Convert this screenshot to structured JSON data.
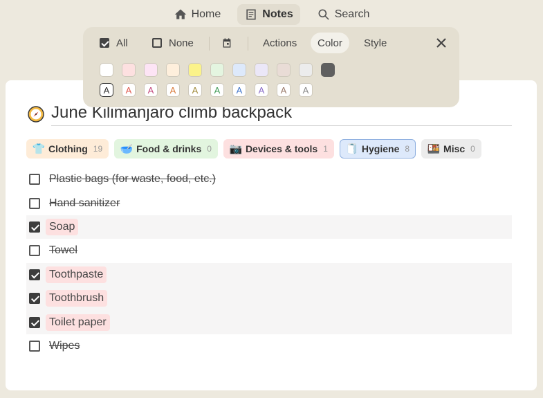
{
  "nav": {
    "home_label": "Home",
    "notes_label": "Notes",
    "search_label": "Search"
  },
  "toolbar": {
    "all_label": "All",
    "none_label": "None",
    "actions_label": "Actions",
    "color_label": "Color",
    "style_label": "Style",
    "background_swatches": [
      "#ffffff",
      "#fde0e0",
      "#fde4f5",
      "#feefdc",
      "#fbf38a",
      "#e4f5e0",
      "#dde9fb",
      "#ebe7f8",
      "#e9dcd6",
      "#ececec",
      "#5f5f5f"
    ],
    "text_swatches": [
      {
        "label": "A",
        "color": "#333333"
      },
      {
        "label": "A",
        "color": "#e05a4f"
      },
      {
        "label": "A",
        "color": "#c2477c"
      },
      {
        "label": "A",
        "color": "#d97a3a"
      },
      {
        "label": "A",
        "color": "#a08a3a"
      },
      {
        "label": "A",
        "color": "#3f9a55"
      },
      {
        "label": "A",
        "color": "#3f74c9"
      },
      {
        "label": "A",
        "color": "#8a6cc8"
      },
      {
        "label": "A",
        "color": "#9a7a6a"
      },
      {
        "label": "A",
        "color": "#888888"
      }
    ]
  },
  "note": {
    "title": "June Kilimanjaro climb backpack"
  },
  "categories": [
    {
      "emoji": "👕",
      "name": "Clothing",
      "count": "19",
      "bg": "#feecd8",
      "border": "#feecd8"
    },
    {
      "emoji": "🥣",
      "name": "Food & drinks",
      "count": "0",
      "bg": "#e2f5df",
      "border": "#e2f5df"
    },
    {
      "emoji": "📷",
      "name": "Devices & tools",
      "count": "1",
      "bg": "#fde0e0",
      "border": "#fde0e0"
    },
    {
      "emoji": "🧻",
      "name": "Hygiene",
      "count": "8",
      "bg": "#dde9fb",
      "border": "#8fb0e0"
    },
    {
      "emoji": "🍱",
      "name": "Misc",
      "count": "0",
      "bg": "#ececec",
      "border": "#ececec"
    }
  ],
  "items": [
    {
      "text": "Plastic bags (for waste, food, etc.)",
      "checked": false
    },
    {
      "text": "Hand sanitizer",
      "checked": false
    },
    {
      "text": "Soap",
      "checked": true
    },
    {
      "text": "Towel",
      "checked": false
    },
    {
      "text": "Toothpaste",
      "checked": true
    },
    {
      "text": "Toothbrush",
      "checked": true
    },
    {
      "text": "Toilet paper",
      "checked": true
    },
    {
      "text": "Wipes",
      "checked": false
    }
  ]
}
